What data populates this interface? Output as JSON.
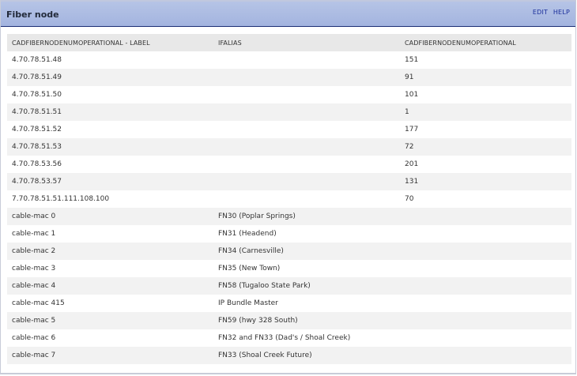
{
  "header": {
    "title": "Fiber node",
    "edit_label": "EDIT",
    "help_label": "HELP"
  },
  "table": {
    "columns": [
      "CADFIBERNODENUMOPERATIONAL - LABEL",
      "IFALIAS",
      "CADFIBERNODENUMOPERATIONAL"
    ],
    "rows": [
      [
        "4.70.78.51.48",
        "",
        "151"
      ],
      [
        "4.70.78.51.49",
        "",
        "91"
      ],
      [
        "4.70.78.51.50",
        "",
        "101"
      ],
      [
        "4.70.78.51.51",
        "",
        "1"
      ],
      [
        "4.70.78.51.52",
        "",
        "177"
      ],
      [
        "4.70.78.51.53",
        "",
        "72"
      ],
      [
        "4.70.78.53.56",
        "",
        "201"
      ],
      [
        "4.70.78.53.57",
        "",
        "131"
      ],
      [
        "7.70.78.51.51.111.108.100",
        "",
        "70"
      ],
      [
        "cable-mac 0",
        "FN30 (Poplar Springs)",
        ""
      ],
      [
        "cable-mac 1",
        "FN31 (Headend)",
        ""
      ],
      [
        "cable-mac 2",
        "FN34 (Carnesville)",
        ""
      ],
      [
        "cable-mac 3",
        "FN35 (New Town)",
        ""
      ],
      [
        "cable-mac 4",
        "FN58 (Tugaloo State Park)",
        ""
      ],
      [
        "cable-mac 415",
        "IP Bundle Master",
        ""
      ],
      [
        "cable-mac 5",
        "FN59 (hwy 328 South)",
        ""
      ],
      [
        "cable-mac 6",
        "FN32 and FN33 (Dad's / Shoal Creek)",
        ""
      ],
      [
        "cable-mac 7",
        "FN33 (Shoal Creek Future)",
        ""
      ]
    ]
  }
}
